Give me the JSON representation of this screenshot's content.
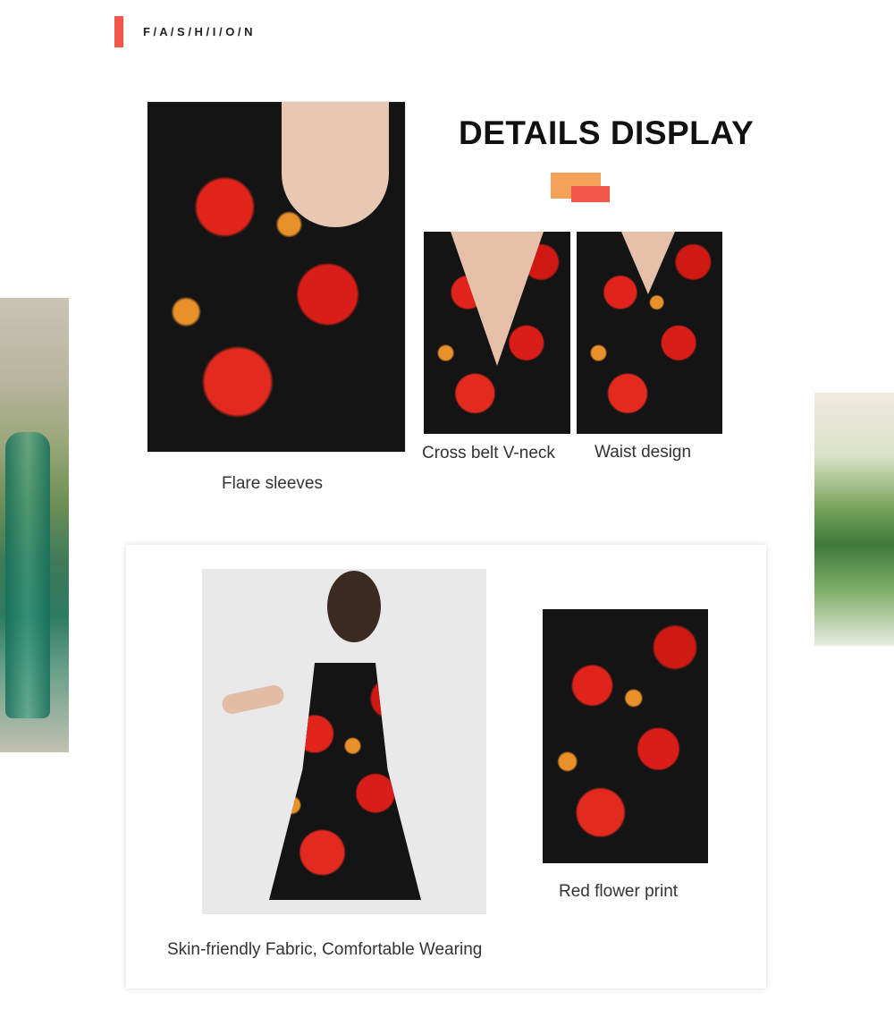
{
  "header": {
    "brand": "F / A / S / H / I / O / N"
  },
  "details": {
    "title": "DETAILS DISPLAY",
    "captions": {
      "flare_sleeves": "Flare sleeves",
      "cross_belt": "Cross belt V-neck",
      "waist": "Waist design"
    }
  },
  "card": {
    "fabric_caption": "Skin-friendly Fabric, Comfortable Wearing",
    "print_caption": "Red flower print"
  },
  "colors": {
    "accent_red": "#f2564a",
    "accent_orange": "#f4a259",
    "dress_black": "#141414",
    "flower_red": "#e0241b"
  }
}
